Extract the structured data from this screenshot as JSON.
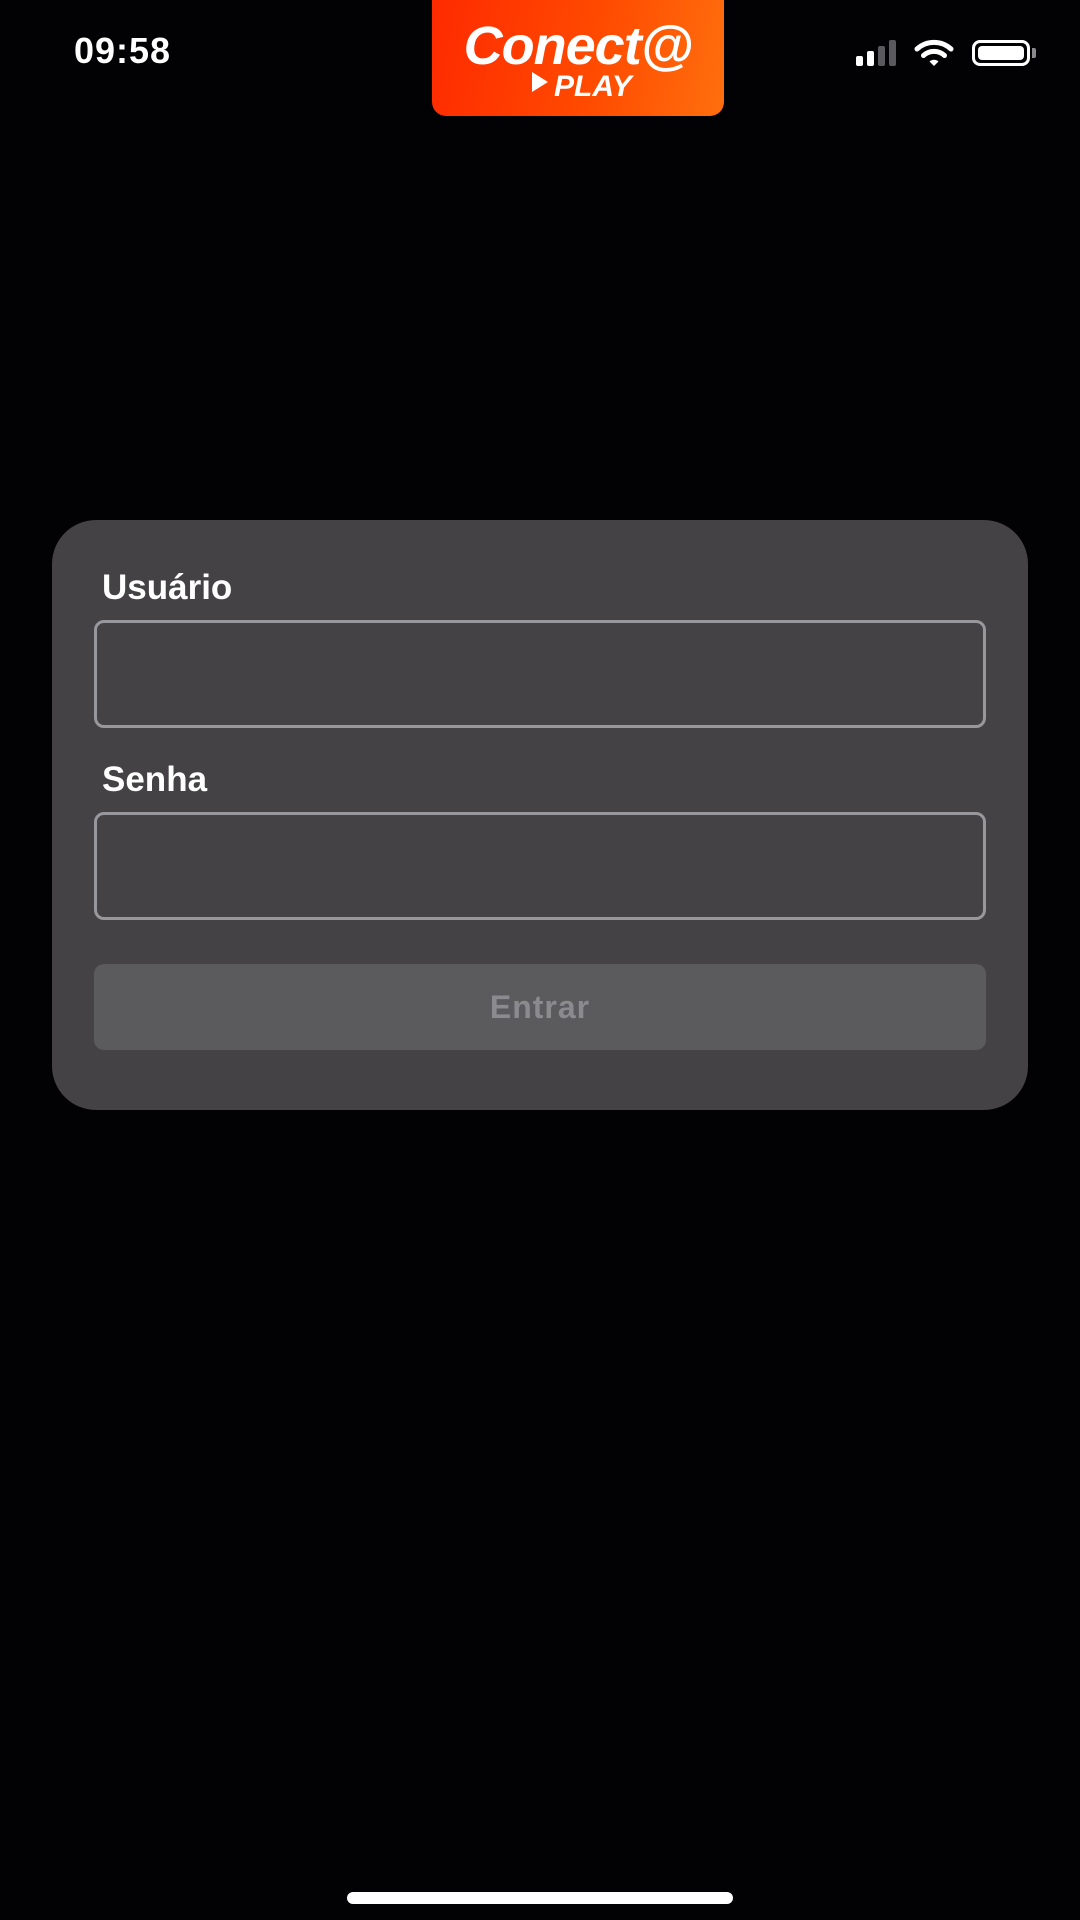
{
  "status_bar": {
    "time": "09:58",
    "signal_level": "3 of 4 bars",
    "wifi": "connected",
    "battery_level": 1.0,
    "icons": [
      "signal-icon",
      "wifi-icon",
      "battery-icon"
    ]
  },
  "brand": {
    "name": "Conect@",
    "tagline": "PLAY",
    "icons": [
      "play-icon"
    ],
    "colors": {
      "gradient_start": "#ff2a00",
      "gradient_end": "#ff6f0e"
    }
  },
  "login_form": {
    "username_label": "Usuário",
    "username_value": "",
    "password_label": "Senha",
    "password_value": "",
    "submit_label": "Entrar",
    "submit_enabled": false
  },
  "colors": {
    "background": "#020103",
    "card": "#444245",
    "input_border": "#98979b",
    "button_disabled": "#5b5a5d",
    "button_text_disabled": "#8b8a8e"
  }
}
